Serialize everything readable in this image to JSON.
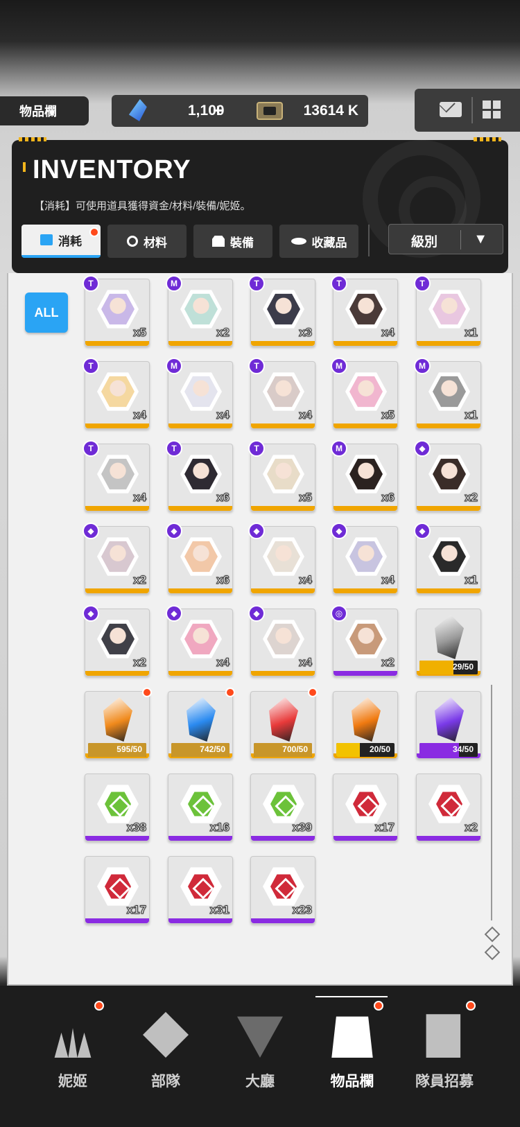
{
  "top": {
    "section_label": "物品欄",
    "gems": "1,100",
    "gems_plus": "+",
    "credits": "13614 K"
  },
  "header": {
    "title": "INVENTORY",
    "description": "【消耗】可使用道具獲得資金/材料/裝備/妮姬。",
    "tabs": [
      {
        "label": "消耗",
        "active": true,
        "badge": true
      },
      {
        "label": "材料",
        "active": false,
        "badge": false
      },
      {
        "label": "裝備",
        "active": false,
        "badge": false
      },
      {
        "label": "收藏品",
        "active": false,
        "badge": false
      }
    ],
    "sort_label": "級別",
    "sort_arrow": "▼"
  },
  "filter": {
    "all_label": "ALL"
  },
  "items": [
    {
      "kind": "portrait",
      "rarity": "T",
      "count": "x5",
      "base": "#f0a500",
      "hue": "#c9b8e8"
    },
    {
      "kind": "portrait",
      "rarity": "M",
      "count": "x2",
      "base": "#f0a500",
      "hue": "#bfe0d8"
    },
    {
      "kind": "portrait",
      "rarity": "T",
      "count": "x3",
      "base": "#f0a500",
      "hue": "#3c3c4a"
    },
    {
      "kind": "portrait",
      "rarity": "T",
      "count": "x4",
      "base": "#f0a500",
      "hue": "#4a3a38"
    },
    {
      "kind": "portrait",
      "rarity": "T",
      "count": "x1",
      "base": "#f0a500",
      "hue": "#e9c7e0"
    },
    {
      "kind": "portrait",
      "rarity": "T",
      "count": "x4",
      "base": "#f0a500",
      "hue": "#f5d8a0"
    },
    {
      "kind": "portrait",
      "rarity": "M",
      "count": "x4",
      "base": "#f0a500",
      "hue": "#e4e4ee"
    },
    {
      "kind": "portrait",
      "rarity": "T",
      "count": "x4",
      "base": "#f0a500",
      "hue": "#d9cbc8"
    },
    {
      "kind": "portrait",
      "rarity": "M",
      "count": "x5",
      "base": "#f0a500",
      "hue": "#f1b6cf"
    },
    {
      "kind": "portrait",
      "rarity": "M",
      "count": "x1",
      "base": "#f0a500",
      "hue": "#9a9a9a"
    },
    {
      "kind": "portrait",
      "rarity": "T",
      "count": "x4",
      "base": "#f0a500",
      "hue": "#c4c4c4"
    },
    {
      "kind": "portrait",
      "rarity": "T",
      "count": "x6",
      "base": "#f0a500",
      "hue": "#2e2a32"
    },
    {
      "kind": "portrait",
      "rarity": "T",
      "count": "x5",
      "base": "#f0a500",
      "hue": "#e8dcc8"
    },
    {
      "kind": "portrait",
      "rarity": "M",
      "count": "x6",
      "base": "#f0a500",
      "hue": "#2b2220"
    },
    {
      "kind": "portrait",
      "rarity": "◆",
      "count": "x2",
      "base": "#f0a500",
      "hue": "#3a2c28"
    },
    {
      "kind": "portrait",
      "rarity": "◆",
      "count": "x2",
      "base": "#f0a500",
      "hue": "#d8c8d0"
    },
    {
      "kind": "portrait",
      "rarity": "◆",
      "count": "x6",
      "base": "#f0a500",
      "hue": "#f2c8a8"
    },
    {
      "kind": "portrait",
      "rarity": "◆",
      "count": "x4",
      "base": "#f0a500",
      "hue": "#e8e0d6"
    },
    {
      "kind": "portrait",
      "rarity": "◆",
      "count": "x4",
      "base": "#f0a500",
      "hue": "#c8c4e0"
    },
    {
      "kind": "portrait",
      "rarity": "◆",
      "count": "x1",
      "base": "#f0a500",
      "hue": "#2a2a2a"
    },
    {
      "kind": "portrait",
      "rarity": "◆",
      "count": "x2",
      "base": "#f0a500",
      "hue": "#404048"
    },
    {
      "kind": "portrait",
      "rarity": "◆",
      "count": "x4",
      "base": "#f0a500",
      "hue": "#f0a8c0"
    },
    {
      "kind": "portrait",
      "rarity": "◆",
      "count": "x4",
      "base": "#f0a500",
      "hue": "#ddd4d0"
    },
    {
      "kind": "portrait",
      "rarity": "◎",
      "count": "x2",
      "base": "#8a2be2",
      "hue": "#c89a7a"
    },
    {
      "kind": "crystal",
      "count": "29/50",
      "base": "#f0a500",
      "color": "#9a9a9a",
      "progress": 0.58,
      "fill": "#f0b000",
      "badge": false
    },
    {
      "kind": "crystal",
      "count": "595/50",
      "base": "#f0a500",
      "color": "#f08a1c",
      "progress": 1.0,
      "fill": "#c8962a",
      "badge": true
    },
    {
      "kind": "crystal",
      "count": "742/50",
      "base": "#f0a500",
      "color": "#2a8af0",
      "progress": 1.0,
      "fill": "#c8962a",
      "badge": true
    },
    {
      "kind": "crystal",
      "count": "700/50",
      "base": "#f0a500",
      "color": "#e83a3a",
      "progress": 1.0,
      "fill": "#c8962a",
      "badge": true
    },
    {
      "kind": "crystal",
      "count": "20/50",
      "base": "#f0a500",
      "color": "#f07a10",
      "progress": 0.4,
      "fill": "#f2c200",
      "badge": false
    },
    {
      "kind": "crystal",
      "count": "34/50",
      "base": "#8a2be2",
      "color": "#7a3ae8",
      "progress": 0.68,
      "fill": "#8a2be2",
      "badge": false
    },
    {
      "kind": "material",
      "count": "x38",
      "base": "#8a2be2",
      "color": "#6cc23a"
    },
    {
      "kind": "material",
      "count": "x16",
      "base": "#8a2be2",
      "color": "#6cc23a"
    },
    {
      "kind": "material",
      "count": "x39",
      "base": "#8a2be2",
      "color": "#6cc23a"
    },
    {
      "kind": "material",
      "count": "x17",
      "base": "#8a2be2",
      "color": "#d02a3a"
    },
    {
      "kind": "material",
      "count": "x2",
      "base": "#8a2be2",
      "color": "#d02a3a"
    },
    {
      "kind": "material",
      "count": "x17",
      "base": "#8a2be2",
      "color": "#d02a3a"
    },
    {
      "kind": "material",
      "count": "x31",
      "base": "#8a2be2",
      "color": "#d02a3a"
    },
    {
      "kind": "material",
      "count": "x23",
      "base": "#8a2be2",
      "color": "#d02a3a"
    }
  ],
  "nav": [
    {
      "label": "妮姬",
      "icon": "people-icon",
      "active": false,
      "badge": true
    },
    {
      "label": "部隊",
      "icon": "squad-icon",
      "active": false,
      "badge": false
    },
    {
      "label": "大廳",
      "icon": "lobby-icon",
      "active": false,
      "badge": false
    },
    {
      "label": "物品欄",
      "icon": "backpack-icon",
      "active": true,
      "badge": true
    },
    {
      "label": "隊員招募",
      "icon": "recruit-icon",
      "active": false,
      "badge": true
    }
  ]
}
